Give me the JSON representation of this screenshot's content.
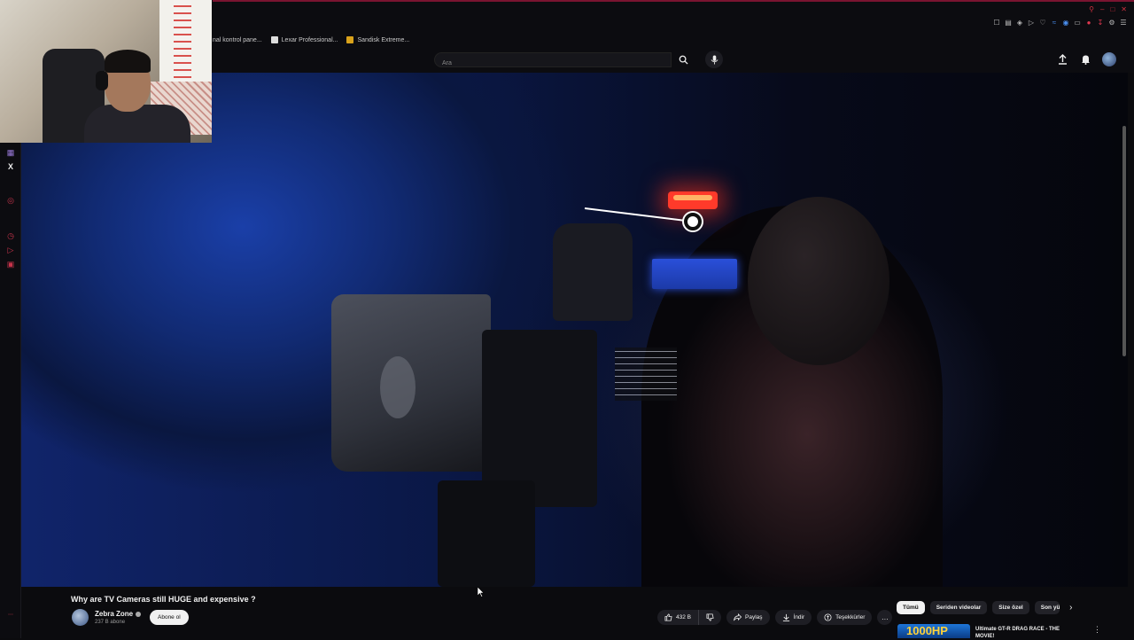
{
  "browser": {
    "bookmarks": [
      {
        "label": "nal kontrol pane...",
        "icon": "page-icon"
      },
      {
        "label": "Lexar Professional...",
        "icon": "lexar-icon"
      },
      {
        "label": "Sandisk Extreme...",
        "icon": "sandisk-icon"
      }
    ],
    "window_controls": [
      "–",
      "□",
      "✕"
    ],
    "accent_color": "#7a1430"
  },
  "youtube": {
    "search": {
      "placeholder": "Ara"
    },
    "header_icons": [
      "upload-icon",
      "bell-icon",
      "avatar"
    ]
  },
  "video": {
    "title": "Why are TV Cameras still HUGE and expensive ?",
    "channel": {
      "name": "Zebra Zone",
      "subscribers": "237 B abone",
      "verified": true
    },
    "subscribe_label": "Abone ol",
    "actions": {
      "like_count": "432 B",
      "share_label": "Paylaş",
      "download_label": "İndir",
      "thanks_label": "Teşekkürler",
      "more": "…"
    }
  },
  "sidebar": {
    "chips": [
      "Tümü",
      "Seriden videolar",
      "Size özel",
      "Son yü"
    ],
    "recommendation": {
      "thumbnail_text": "1000HP",
      "title": "Ultimate GT-R DRAG RACE - THE MOVIE!",
      "menu": "⋮"
    }
  },
  "colors": {
    "background": "#0b0b0e",
    "brand_red": "#d0303f",
    "tally_light": "#ff3a2a",
    "video_blue": "#1a3fa8"
  }
}
